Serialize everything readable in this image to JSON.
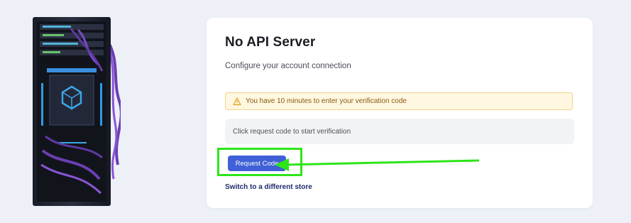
{
  "page": {
    "title": "No API Server",
    "subtitle": "Configure your account connection"
  },
  "warning": {
    "icon": "warning-triangle-icon",
    "text": "You have 10 minutes to enter your verification code",
    "color": "#8a5a10",
    "background": "#fff7e0"
  },
  "info": {
    "text": "Click request code to start verification"
  },
  "actions": {
    "request_code_label": "Request Code",
    "switch_store_label": "Switch to a different store",
    "button_color": "#3f60d6"
  },
  "annotation": {
    "highlight_color": "#2ee51a"
  }
}
